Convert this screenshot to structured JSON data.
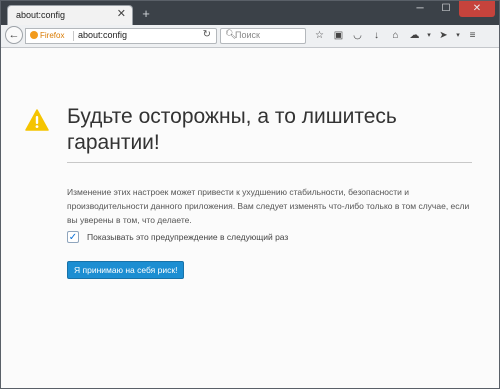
{
  "tab": {
    "title": "about:config",
    "close": "✕"
  },
  "new_tab": "+",
  "window_controls": {
    "minimize": "─",
    "maximize": "☐",
    "close": "✕"
  },
  "navbar": {
    "back": "←",
    "identity": "Firefox",
    "url": "about:config",
    "reload": "↻",
    "search_placeholder": "Поиск",
    "icons": [
      "star-icon",
      "clipboard-icon",
      "pocket-icon",
      "download-icon",
      "home-icon",
      "chat-icon",
      "dropdown-icon",
      "extension-icon",
      "dropdown-icon",
      "menu-icon"
    ]
  },
  "page": {
    "title": "Будьте осторожны, а то лишитесь гарантии!",
    "description": "Изменение этих настроек может привести к ухудшению стабильности, безопасности и производительности данного приложения. Вам следует изменять что-либо только в том случае, если вы уверены в том, что делаете.",
    "checkbox_label": "Показывать это предупреждение в следующий раз",
    "checkbox_checked": true,
    "accept_button": "Я принимаю на себя риск!"
  },
  "colors": {
    "warning": "#f5c400",
    "accent": "#1c8ed2"
  }
}
